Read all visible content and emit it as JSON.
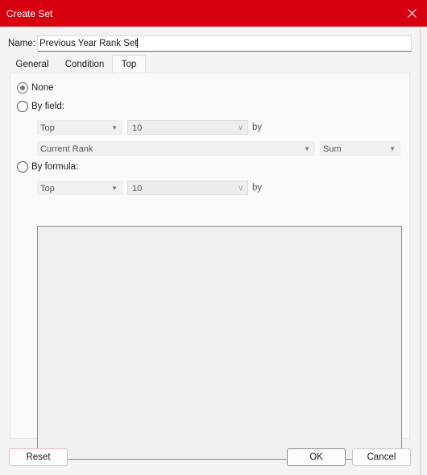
{
  "window": {
    "title": "Create Set"
  },
  "name": {
    "label": "Name:",
    "value": "Previous Year Rank Set"
  },
  "tabs": [
    {
      "label": "General",
      "active": false
    },
    {
      "label": "Condition",
      "active": false
    },
    {
      "label": "Top",
      "active": true
    }
  ],
  "top_tab": {
    "none_label": "None",
    "by_field": {
      "label": "By field:",
      "direction": "Top",
      "count": "10",
      "by_label": "by",
      "field": "Current Rank",
      "aggregation": "Sum"
    },
    "by_formula": {
      "label": "By formula:",
      "direction": "Top",
      "count": "10",
      "by_label": "by",
      "formula_text": ""
    },
    "selected_option": "None"
  },
  "buttons": {
    "reset": "Reset",
    "ok": "OK",
    "cancel": "Cancel"
  },
  "colors": {
    "titlebar": "#d7000f",
    "dialog_bg": "#f3f3f3",
    "panel_bg": "#fafafa"
  },
  "icons": {
    "close": "close-icon",
    "dropdown": "chevron-down-icon"
  }
}
